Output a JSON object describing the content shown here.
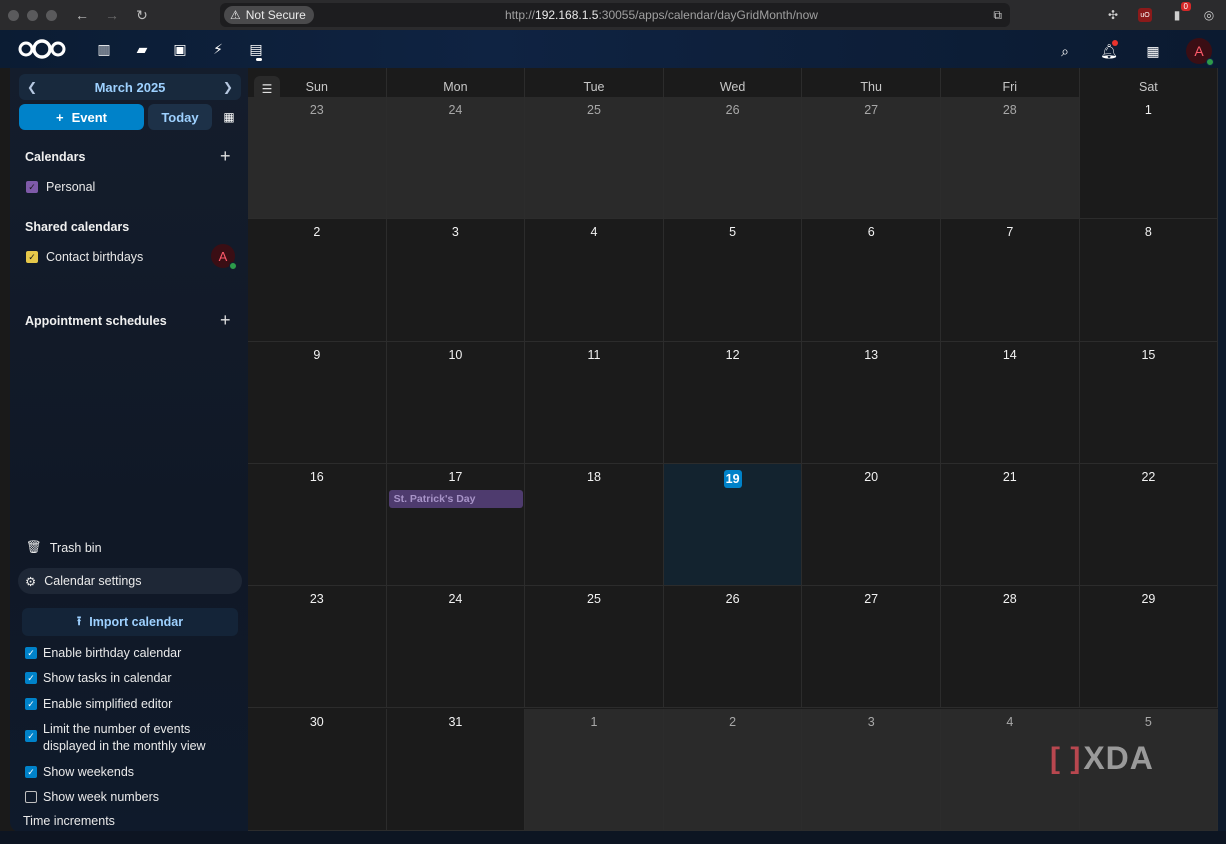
{
  "browser": {
    "security_label": "Not Secure",
    "url_prefix": "http://",
    "url_host": "192.168.1.5",
    "url_rest": ":30055/apps/calendar/dayGridMonth/now",
    "ext_badge": "0",
    "ub_label": "uO"
  },
  "header": {
    "avatar_letter": "A"
  },
  "sidebar": {
    "month_label": "March 2025",
    "event_button": "Event",
    "today_button": "Today",
    "calendars_title": "Calendars",
    "calendars": [
      {
        "name": "Personal",
        "color": "#7e5aa8"
      }
    ],
    "shared_title": "Shared calendars",
    "shared": [
      {
        "name": "Contact birthdays",
        "color": "#e6c84a",
        "owner_avatar": "A"
      }
    ],
    "appointments_title": "Appointment schedules",
    "trash_label": "Trash bin",
    "settings_label": "Calendar settings",
    "import_label": "Import calendar",
    "options": [
      {
        "label": "Enable birthday calendar",
        "checked": true
      },
      {
        "label": "Show tasks in calendar",
        "checked": true
      },
      {
        "label": "Enable simplified editor",
        "checked": true
      },
      {
        "label": "Limit the number of events displayed in the monthly view",
        "checked": true
      },
      {
        "label": "Show weekends",
        "checked": true
      },
      {
        "label": "Show week numbers",
        "checked": false
      }
    ],
    "time_increments_label": "Time increments"
  },
  "calendar": {
    "days_of_week": [
      "Sun",
      "Mon",
      "Tue",
      "Wed",
      "Thu",
      "Fri",
      "Sat"
    ],
    "weeks": [
      [
        {
          "d": "23",
          "o": true
        },
        {
          "d": "24",
          "o": true
        },
        {
          "d": "25",
          "o": true
        },
        {
          "d": "26",
          "o": true
        },
        {
          "d": "27",
          "o": true
        },
        {
          "d": "28",
          "o": true
        },
        {
          "d": "1",
          "o": false
        }
      ],
      [
        {
          "d": "2"
        },
        {
          "d": "3"
        },
        {
          "d": "4"
        },
        {
          "d": "5"
        },
        {
          "d": "6"
        },
        {
          "d": "7"
        },
        {
          "d": "8"
        }
      ],
      [
        {
          "d": "9"
        },
        {
          "d": "10"
        },
        {
          "d": "11"
        },
        {
          "d": "12"
        },
        {
          "d": "13"
        },
        {
          "d": "14"
        },
        {
          "d": "15"
        }
      ],
      [
        {
          "d": "16"
        },
        {
          "d": "17",
          "event": "St. Patrick's Day"
        },
        {
          "d": "18"
        },
        {
          "d": "19",
          "today": true
        },
        {
          "d": "20"
        },
        {
          "d": "21"
        },
        {
          "d": "22"
        }
      ],
      [
        {
          "d": "23"
        },
        {
          "d": "24"
        },
        {
          "d": "25"
        },
        {
          "d": "26"
        },
        {
          "d": "27"
        },
        {
          "d": "28"
        },
        {
          "d": "29"
        }
      ],
      [
        {
          "d": "30"
        },
        {
          "d": "31"
        },
        {
          "d": "1",
          "o": true
        },
        {
          "d": "2",
          "o": true
        },
        {
          "d": "3",
          "o": true
        },
        {
          "d": "4",
          "o": true
        },
        {
          "d": "5",
          "o": true
        }
      ]
    ]
  },
  "watermark": "XDA",
  "accent_color": "#0082c9"
}
